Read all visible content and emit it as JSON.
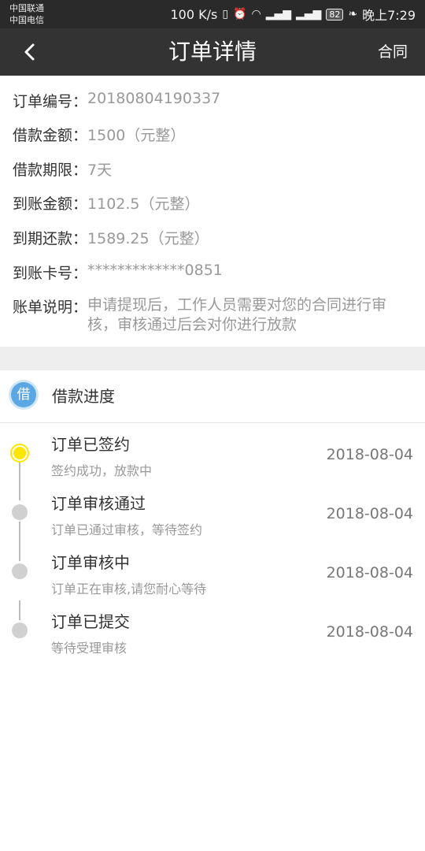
{
  "status_bar": {
    "carrier1": "中国联通",
    "carrier2": "中国电信",
    "speed": "100 K/s",
    "battery": "82",
    "time": "晚上7:29"
  },
  "nav": {
    "title": "订单详情",
    "right_button": "合同"
  },
  "order": {
    "number_label": "订单编号：",
    "number": "20180804190337",
    "amount_label": "借款金额：",
    "amount": "1500（元整）",
    "term_label": "借款期限：",
    "term": "7天",
    "received_label": "到账金额：",
    "received": "1102.5（元整）",
    "repay_label": "到期还款：",
    "repay": "1589.25（元整）",
    "card_label": "到账卡号：",
    "card": "*************0851",
    "note_label": "账单说明：",
    "note": "申请提现后，工作人员需要对您的合同进行审核，审核通过后会对你进行放款"
  },
  "progress": {
    "icon_text": "借",
    "title": "借款进度",
    "steps": [
      {
        "title": "订单已签约",
        "desc": "签约成功，放款中",
        "date": "2018-08-04"
      },
      {
        "title": "订单审核通过",
        "desc": "订单已通过审核，等待签约",
        "date": "2018-08-04"
      },
      {
        "title": "订单审核中",
        "desc": "订单正在审核,请您耐心等待",
        "date": "2018-08-04"
      },
      {
        "title": "订单已提交",
        "desc": "等待受理审核",
        "date": "2018-08-04"
      }
    ]
  },
  "colors": {
    "nav_bg": "#333333",
    "active_dot": "#ffe600",
    "inactive_dot": "#d0d0d0",
    "badge_blue": "#5aa7e3"
  }
}
